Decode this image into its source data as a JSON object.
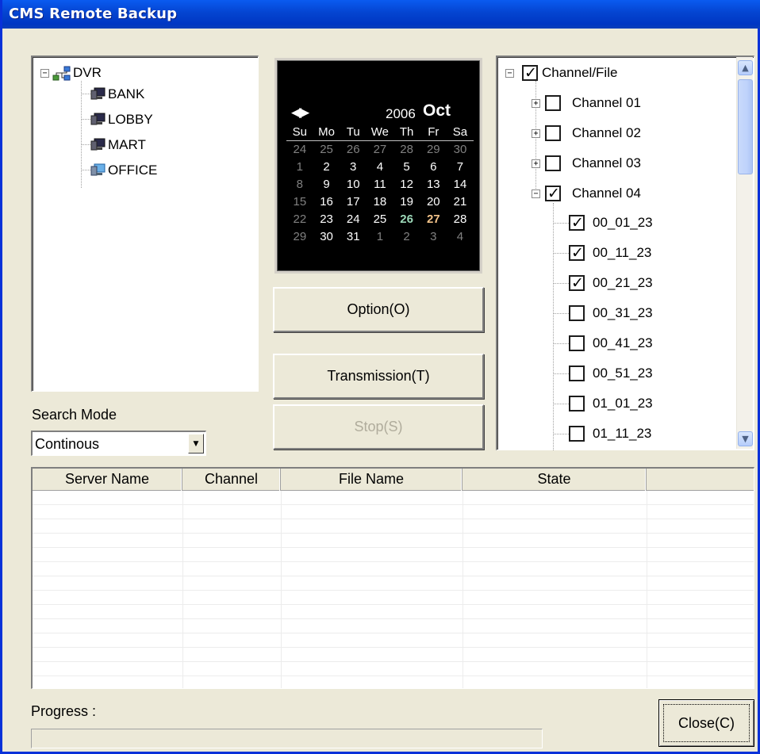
{
  "window": {
    "title": "CMS Remote Backup"
  },
  "device_tree": {
    "root": "DVR",
    "children": [
      "BANK",
      "LOBBY",
      "MART",
      "OFFICE"
    ]
  },
  "calendar": {
    "year": "2006",
    "month": "Oct",
    "nav": "◀▶",
    "weekdays": [
      "Su",
      "Mo",
      "Tu",
      "We",
      "Th",
      "Fr",
      "Sa"
    ],
    "weeks": [
      [
        "24",
        "25",
        "26",
        "27",
        "28",
        "29",
        "30"
      ],
      [
        "1",
        "2",
        "3",
        "4",
        "5",
        "6",
        "7"
      ],
      [
        "8",
        "9",
        "10",
        "11",
        "12",
        "13",
        "14"
      ],
      [
        "15",
        "16",
        "17",
        "18",
        "19",
        "20",
        "21"
      ],
      [
        "22",
        "23",
        "24",
        "25",
        "26",
        "27",
        "28"
      ],
      [
        "29",
        "30",
        "31",
        "1",
        "2",
        "3",
        "4"
      ]
    ]
  },
  "buttons": {
    "option": "Option(O)",
    "transmission": "Transmission(T)",
    "stop": "Stop(S)",
    "close": "Close(C)"
  },
  "channel_tree": {
    "root": "Channel/File",
    "channels": [
      "Channel 01",
      "Channel 02",
      "Channel 03",
      "Channel 04"
    ],
    "files": [
      "00_01_23",
      "00_11_23",
      "00_21_23",
      "00_31_23",
      "00_41_23",
      "00_51_23",
      "01_01_23",
      "01_11_23"
    ],
    "file_checked": [
      true,
      true,
      true,
      false,
      false,
      false,
      false,
      false
    ]
  },
  "search_mode": {
    "label": "Search Mode",
    "value": "Continous"
  },
  "table": {
    "headers": [
      "Server Name",
      "Channel",
      "File Name",
      "State",
      ""
    ]
  },
  "progress": {
    "label": "Progress :"
  }
}
